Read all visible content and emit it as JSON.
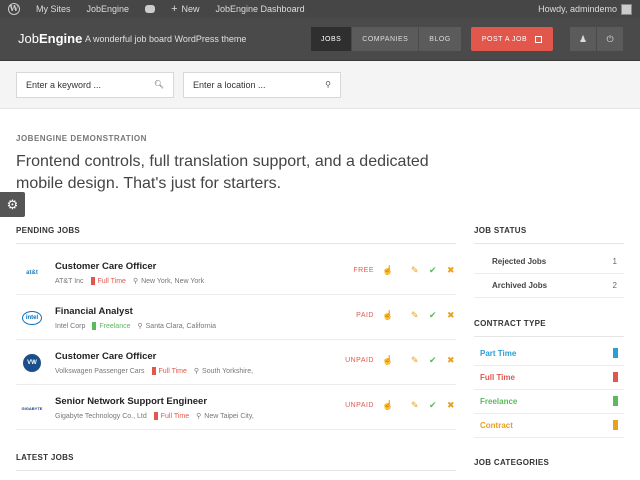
{
  "adminbar": {
    "wp_logo": "W",
    "my_sites": "My Sites",
    "site_name": "JobEngine",
    "comments_icon": "speech-bubble-icon",
    "new_label": "New",
    "dashboard": "JobEngine Dashboard",
    "howdy": "Howdy, admindemo"
  },
  "header": {
    "logo_light": "Job",
    "logo_bold": "Engine",
    "tagline": "A wonderful job board WordPress theme",
    "nav": [
      "JOBS",
      "COMPANIES",
      "BLOG"
    ],
    "post_job": "POST A JOB",
    "user_icon": "user-icon",
    "power_icon": "power-icon"
  },
  "search": {
    "keyword_placeholder": "Enter a keyword ...",
    "location_placeholder": "Enter a location ..."
  },
  "intro": {
    "label": "JOBENGINE DEMONSTRATION",
    "headline": "Frontend controls, full translation support, and a dedicated mobile design. That's just for starters."
  },
  "pending": {
    "title": "PENDING JOBS",
    "jobs": [
      {
        "logo": "at&t",
        "title": "Customer Care Officer",
        "company": "AT&T Inc",
        "contract": "Full Time",
        "location": "New York, New York",
        "status": "FREE"
      },
      {
        "logo": "intel",
        "title": "Financial Analyst",
        "company": "Intel Corp",
        "contract": "Freelance",
        "location": "Santa Clara, California",
        "status": "PAID"
      },
      {
        "logo": "VW",
        "title": "Customer Care Officer",
        "company": "Volkswagen Passenger Cars",
        "contract": "Full Time",
        "location": "South Yorkshire,",
        "status": "UNPAID"
      },
      {
        "logo": "GIGABYTE",
        "title": "Senior Network Support Engineer",
        "company": "Gigabyte Technology Co., Ltd",
        "contract": "Full Time",
        "location": "New Taipei City,",
        "status": "UNPAID"
      }
    ]
  },
  "latest": {
    "title": "LATEST JOBS"
  },
  "sidebar": {
    "job_status_title": "JOB STATUS",
    "job_status": [
      {
        "label": "Rejected Jobs",
        "count": "1"
      },
      {
        "label": "Archived Jobs",
        "count": "2"
      }
    ],
    "contract_title": "CONTRACT TYPE",
    "contracts": [
      {
        "label": "Part Time",
        "color": "#2a9fd6"
      },
      {
        "label": "Full Time",
        "color": "#e2574c"
      },
      {
        "label": "Freelance",
        "color": "#5cb85c"
      },
      {
        "label": "Contract",
        "color": "#e8a020"
      }
    ],
    "categories_title": "JOB CATEGORIES"
  },
  "colors": {
    "accent": "#e2574c",
    "header_bg": "#4a4a4a",
    "full_time": "#e2574c",
    "freelance": "#5cb85c"
  }
}
